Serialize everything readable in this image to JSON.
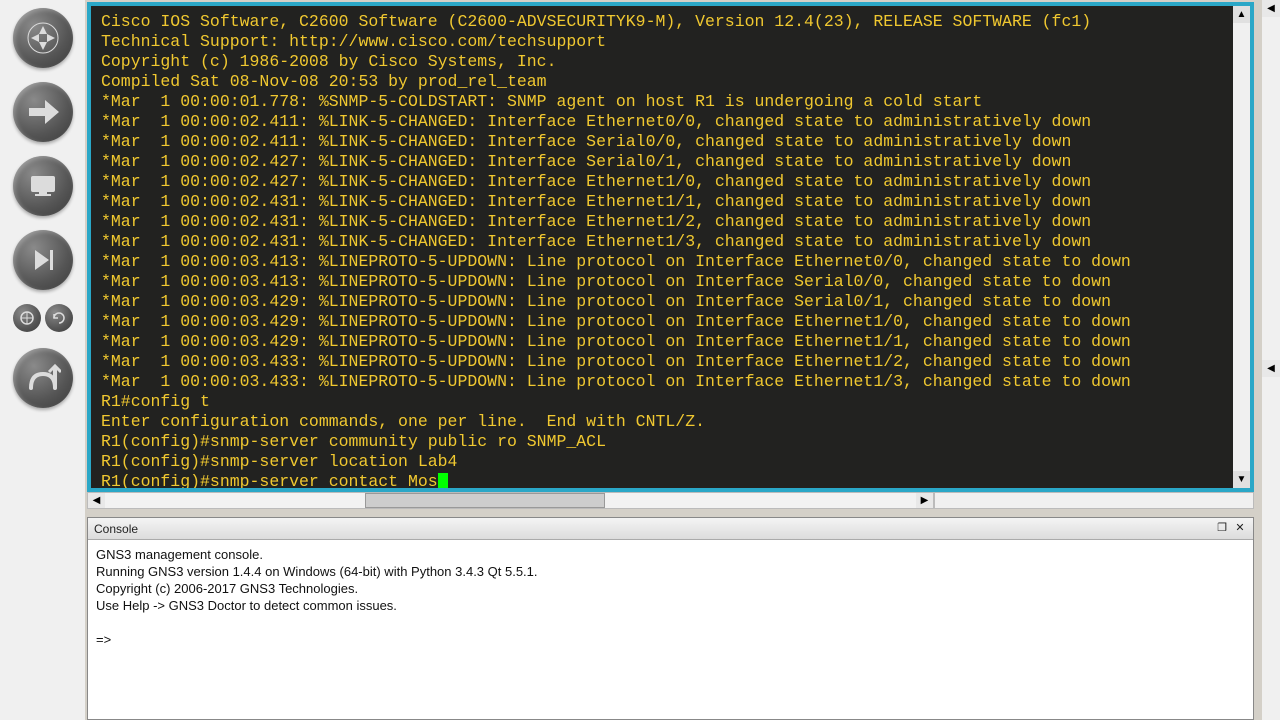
{
  "tools": {
    "router": "router",
    "link": "link",
    "host": "host",
    "play": "play",
    "console": "console",
    "capture": "capture",
    "path": "path"
  },
  "terminal": {
    "lines": [
      "Cisco IOS Software, C2600 Software (C2600-ADVSECURITYK9-M), Version 12.4(23), RELEASE SOFTWARE (fc1)",
      "Technical Support: http://www.cisco.com/techsupport",
      "Copyright (c) 1986-2008 by Cisco Systems, Inc.",
      "Compiled Sat 08-Nov-08 20:53 by prod_rel_team",
      "*Mar  1 00:00:01.778: %SNMP-5-COLDSTART: SNMP agent on host R1 is undergoing a cold start",
      "*Mar  1 00:00:02.411: %LINK-5-CHANGED: Interface Ethernet0/0, changed state to administratively down",
      "*Mar  1 00:00:02.411: %LINK-5-CHANGED: Interface Serial0/0, changed state to administratively down",
      "*Mar  1 00:00:02.427: %LINK-5-CHANGED: Interface Serial0/1, changed state to administratively down",
      "*Mar  1 00:00:02.427: %LINK-5-CHANGED: Interface Ethernet1/0, changed state to administratively down",
      "*Mar  1 00:00:02.431: %LINK-5-CHANGED: Interface Ethernet1/1, changed state to administratively down",
      "*Mar  1 00:00:02.431: %LINK-5-CHANGED: Interface Ethernet1/2, changed state to administratively down",
      "*Mar  1 00:00:02.431: %LINK-5-CHANGED: Interface Ethernet1/3, changed state to administratively down",
      "*Mar  1 00:00:03.413: %LINEPROTO-5-UPDOWN: Line protocol on Interface Ethernet0/0, changed state to down",
      "*Mar  1 00:00:03.413: %LINEPROTO-5-UPDOWN: Line protocol on Interface Serial0/0, changed state to down",
      "*Mar  1 00:00:03.429: %LINEPROTO-5-UPDOWN: Line protocol on Interface Serial0/1, changed state to down",
      "*Mar  1 00:00:03.429: %LINEPROTO-5-UPDOWN: Line protocol on Interface Ethernet1/0, changed state to down",
      "*Mar  1 00:00:03.429: %LINEPROTO-5-UPDOWN: Line protocol on Interface Ethernet1/1, changed state to down",
      "*Mar  1 00:00:03.433: %LINEPROTO-5-UPDOWN: Line protocol on Interface Ethernet1/2, changed state to down",
      "*Mar  1 00:00:03.433: %LINEPROTO-5-UPDOWN: Line protocol on Interface Ethernet1/3, changed state to down",
      "R1#config t",
      "Enter configuration commands, one per line.  End with CNTL/Z.",
      "R1(config)#snmp-server community public ro SNMP_ACL",
      "R1(config)#snmp-server location Lab4"
    ],
    "prompt_line": "R1(config)#snmp-server contact Mos"
  },
  "console": {
    "title": "Console",
    "lines": [
      "GNS3 management console.",
      "Running GNS3 version 1.4.4 on Windows (64-bit) with Python 3.4.3 Qt 5.5.1.",
      "Copyright (c) 2006-2017 GNS3 Technologies.",
      "Use Help -> GNS3 Doctor to detect common issues.",
      "",
      "=>"
    ]
  }
}
